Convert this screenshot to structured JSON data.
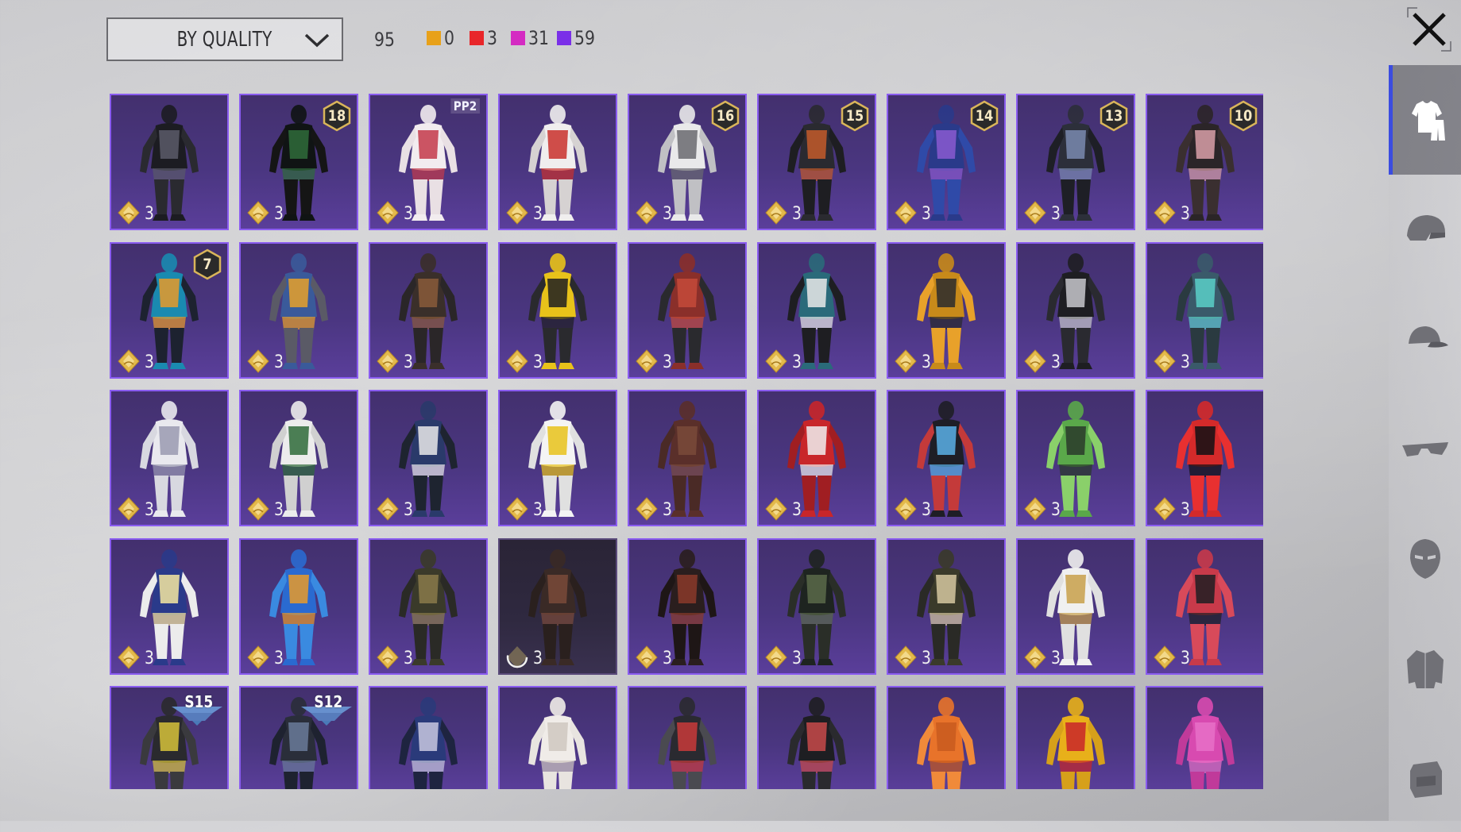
{
  "toolbar": {
    "sort_label": "BY QUALITY",
    "total_count": "95",
    "quality_counts": [
      {
        "color": "#e8a11a",
        "count": "0"
      },
      {
        "color": "#e8262a",
        "count": "3"
      },
      {
        "color": "#d42bc2",
        "count": "31"
      },
      {
        "color": "#7a2fe8",
        "count": "59"
      }
    ]
  },
  "colors": {
    "tile_border": "#8a5cf0",
    "tile_bg": "#4a3680",
    "coin": "#e3b94a",
    "sidebar_active_accent": "#3b4ce0"
  },
  "grid": {
    "columns": 9,
    "items": [
      {
        "outfit": "black-armor",
        "c": [
          "#1c1c22",
          "#5a5a68",
          "#2a2a30"
        ],
        "count": "3"
      },
      {
        "outfit": "green-hoodie",
        "c": [
          "#101414",
          "#2f6b3a",
          "#151515"
        ],
        "count": "3",
        "level": "18"
      },
      {
        "outfit": "heart-pajama",
        "c": [
          "#f2ecef",
          "#c43a4a",
          "#e9e0e4"
        ],
        "count": "3",
        "tag": "PP2"
      },
      {
        "outfit": "christmas-suit",
        "c": [
          "#f0eeee",
          "#c9302c",
          "#d6d2d2"
        ],
        "count": "3"
      },
      {
        "outfit": "white-mech",
        "c": [
          "#e9e9ea",
          "#6a6a70",
          "#c0c0c4"
        ],
        "count": "3",
        "level": "16"
      },
      {
        "outfit": "orange-black",
        "c": [
          "#2a2a30",
          "#c35a2a",
          "#1e1e22"
        ],
        "count": "3",
        "level": "15"
      },
      {
        "outfit": "blue-skirt",
        "c": [
          "#2a3a8a",
          "#8a5ad0",
          "#2f4aa8"
        ],
        "count": "3",
        "level": "14"
      },
      {
        "outfit": "street-jacket",
        "c": [
          "#2c2f3a",
          "#7a8ab0",
          "#1e1f26"
        ],
        "count": "3",
        "level": "13"
      },
      {
        "outfit": "pink-fur",
        "c": [
          "#2b2528",
          "#d9a0a8",
          "#3a2f30"
        ],
        "count": "3",
        "level": "10"
      },
      {
        "outfit": "teal-orange",
        "c": [
          "#1a8ab0",
          "#e89a2a",
          "#1d2230"
        ],
        "count": "3",
        "level": "7"
      },
      {
        "outfit": "orange-vest",
        "c": [
          "#3a5a9a",
          "#e8a12a",
          "#5a5a66"
        ],
        "count": "3"
      },
      {
        "outfit": "camo-warrior",
        "c": [
          "#3a2f2a",
          "#8a5a3a",
          "#2a2628"
        ],
        "count": "3"
      },
      {
        "outfit": "yellow-jacket",
        "c": [
          "#e8c21a",
          "#1e1e22",
          "#2a2a2e"
        ],
        "count": "3"
      },
      {
        "outfit": "red-vest",
        "c": [
          "#8a2f2a",
          "#c44a3a",
          "#2a2a2e"
        ],
        "count": "3"
      },
      {
        "outfit": "teal-sport",
        "c": [
          "#2a6a7a",
          "#e9e9e9",
          "#1e1e22"
        ],
        "count": "3"
      },
      {
        "outfit": "gold-armor",
        "c": [
          "#c88a1a",
          "#2a2a2e",
          "#e8a12a"
        ],
        "count": "3"
      },
      {
        "outfit": "black-suit",
        "c": [
          "#1e1e22",
          "#c8c8cc",
          "#2a2a30"
        ],
        "count": "3"
      },
      {
        "outfit": "teal-camo",
        "c": [
          "#3a5a6a",
          "#5ad0c8",
          "#2a3a40"
        ],
        "count": "3"
      },
      {
        "outfit": "white-dress",
        "c": [
          "#e9e9ee",
          "#9a9ab0",
          "#d8d8e0"
        ],
        "count": "3"
      },
      {
        "outfit": "white-racer",
        "c": [
          "#ececec",
          "#2f6b3a",
          "#d0d0d0"
        ],
        "count": "3"
      },
      {
        "outfit": "navy-racer",
        "c": [
          "#2a3a6a",
          "#e9e9e9",
          "#1e2430"
        ],
        "count": "3"
      },
      {
        "outfit": "white-track",
        "c": [
          "#f4f4f4",
          "#e8c21a",
          "#e0e0e0"
        ],
        "count": "3"
      },
      {
        "outfit": "brown-robe",
        "c": [
          "#5a2f2a",
          "#7a4a3a",
          "#4a2a26"
        ],
        "count": "3"
      },
      {
        "outfit": "red-white",
        "c": [
          "#c8262a",
          "#f0f0f0",
          "#a01e22"
        ],
        "count": "3"
      },
      {
        "outfit": "joker-suit",
        "c": [
          "#1e1e26",
          "#5ab0e8",
          "#c43a3a"
        ],
        "count": "3"
      },
      {
        "outfit": "green-camo",
        "c": [
          "#5aa84a",
          "#2a3a2a",
          "#8ad06a"
        ],
        "count": "3"
      },
      {
        "outfit": "red-black",
        "c": [
          "#d42a2a",
          "#111114",
          "#e83030"
        ],
        "count": "3"
      },
      {
        "outfit": "maid-dress",
        "c": [
          "#2a3a8a",
          "#f4e8a0",
          "#ececec"
        ],
        "count": "3"
      },
      {
        "outfit": "blue-coat",
        "c": [
          "#2a6ad0",
          "#e89a2a",
          "#3a8ae0"
        ],
        "count": "3"
      },
      {
        "outfit": "olive-armor",
        "c": [
          "#3a3a2a",
          "#8a7a4a",
          "#2a2a26"
        ],
        "count": "3"
      },
      {
        "outfit": "brown-leather",
        "c": [
          "#3a2a26",
          "#7a4a3a",
          "#2a201e"
        ],
        "count": "3",
        "dark": true,
        "loading": true
      },
      {
        "outfit": "dark-coat",
        "c": [
          "#2a1e1e",
          "#8a3a2a",
          "#1e1616"
        ],
        "count": "3"
      },
      {
        "outfit": "dark-green",
        "c": [
          "#1e2420",
          "#5a6a4a",
          "#2a2e28"
        ],
        "count": "3"
      },
      {
        "outfit": "trench-coat",
        "c": [
          "#3a3a2a",
          "#d6c8a0",
          "#2a2a26"
        ],
        "count": "3"
      },
      {
        "outfit": "white-cape",
        "c": [
          "#f0f0f0",
          "#c8a04a",
          "#e0e0e0"
        ],
        "count": "3"
      },
      {
        "outfit": "red-tactical",
        "c": [
          "#c83a4a",
          "#1e1e22",
          "#d84a5a"
        ],
        "count": "3"
      },
      {
        "outfit": "yellow-coat",
        "c": [
          "#2a2a2e",
          "#d6c23a",
          "#3a3a3e"
        ],
        "season": "S15"
      },
      {
        "outfit": "dark-armor",
        "c": [
          "#2a2e3a",
          "#6a7a9a",
          "#1e2230"
        ],
        "season": "S12"
      },
      {
        "outfit": "blue-knight",
        "c": [
          "#2a3a7a",
          "#c8c8e0",
          "#1e2440"
        ]
      },
      {
        "outfit": "white-mummy",
        "c": [
          "#f0ece8",
          "#cfc8c0",
          "#e8e4e0"
        ]
      },
      {
        "outfit": "red-moto",
        "c": [
          "#2a2a30",
          "#c83a3a",
          "#4a4a50"
        ]
      },
      {
        "outfit": "red-hood",
        "c": [
          "#1e1e22",
          "#c84a4a",
          "#2a2a2e"
        ]
      },
      {
        "outfit": "orange-jumpsuit",
        "c": [
          "#e8732a",
          "#c85a1e",
          "#f08a3a"
        ]
      },
      {
        "outfit": "yellow-hazmat",
        "c": [
          "#e8b01a",
          "#c8262a",
          "#d6a01a"
        ]
      },
      {
        "outfit": "pink-coat",
        "c": [
          "#d84ab0",
          "#e870c8",
          "#c03a9a"
        ]
      }
    ]
  },
  "sidebar": {
    "tabs": [
      {
        "name": "outfits-tab",
        "icon": "outfit-icon",
        "active": true
      },
      {
        "name": "helmets-tab",
        "icon": "helmet-icon"
      },
      {
        "name": "hats-tab",
        "icon": "cap-icon"
      },
      {
        "name": "glasses-tab",
        "icon": "glasses-icon"
      },
      {
        "name": "masks-tab",
        "icon": "mask-icon"
      },
      {
        "name": "tops-tab",
        "icon": "jacket-icon"
      },
      {
        "name": "backpacks-tab",
        "icon": "backpack-icon"
      }
    ]
  }
}
